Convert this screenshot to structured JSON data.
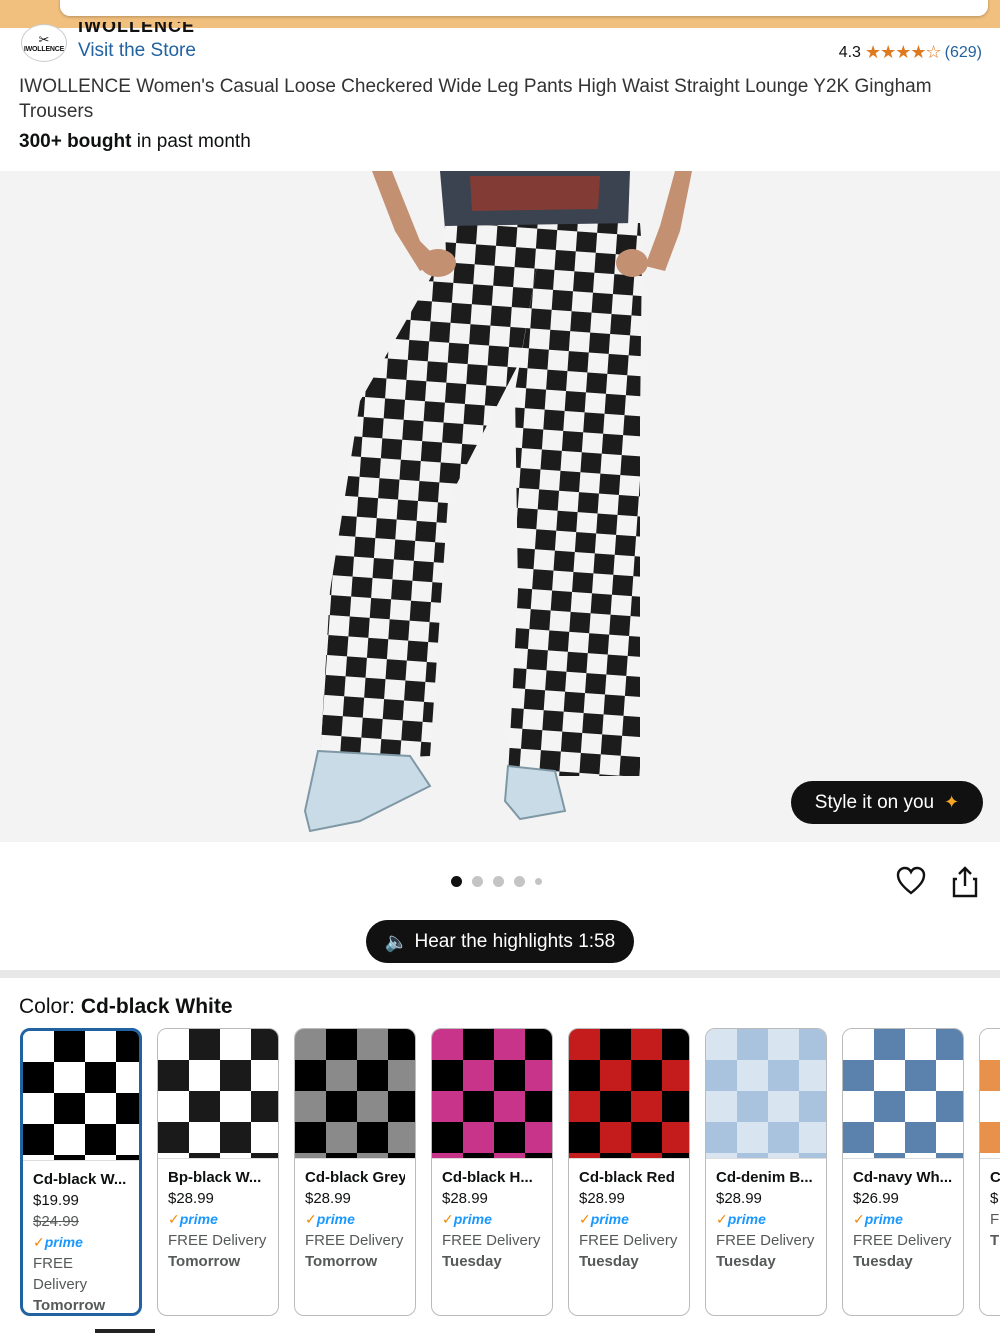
{
  "brand": {
    "name_cut": "IWOLLENCE",
    "logo_text": "IWOLLENCE",
    "visit_store": "Visit the Store"
  },
  "rating": {
    "value": "4.3",
    "stars": "★★★★☆",
    "count": "(629)"
  },
  "product": {
    "title": "IWOLLENCE Women's Casual Loose Checkered Wide Leg Pants High Waist Straight Lounge Y2K Gingham Trousers",
    "bought_bold": "300+ bought",
    "bought_rest": " in past month"
  },
  "image": {
    "style_button": "Style it on you",
    "dots_total": 5,
    "dots_active": 1
  },
  "audio": {
    "label": "Hear the highlights 1:58"
  },
  "color": {
    "label": "Color: ",
    "selected": "Cd-black White"
  },
  "swatches": [
    {
      "name": "Cd-black W...",
      "price": "$19.99",
      "was": "$24.99",
      "prime": "prime",
      "free": "FREE Delivery",
      "day": "Tomorrow",
      "c1": "#000000",
      "c2": "#ffffff"
    },
    {
      "name": "Bp-black W...",
      "price": "$28.99",
      "prime": "prime",
      "free": "FREE Delivery",
      "day": "Tomorrow",
      "c1": "#1a1a1a",
      "c2": "#ffffff"
    },
    {
      "name": "Cd-black Grey",
      "price": "$28.99",
      "prime": "prime",
      "free": "FREE Delivery",
      "day": "Tomorrow",
      "c1": "#000000",
      "c2": "#8a8a8a"
    },
    {
      "name": "Cd-black H...",
      "price": "$28.99",
      "prime": "prime",
      "free": "FREE Delivery",
      "day": "Tuesday",
      "c1": "#000000",
      "c2": "#c8348a"
    },
    {
      "name": "Cd-black Red",
      "price": "$28.99",
      "prime": "prime",
      "free": "FREE Delivery",
      "day": "Tuesday",
      "c1": "#000000",
      "c2": "#c41c1c"
    },
    {
      "name": "Cd-denim B...",
      "price": "$28.99",
      "prime": "prime",
      "free": "FREE Delivery",
      "day": "Tuesday",
      "c1": "#a9c3de",
      "c2": "#d8e5f1"
    },
    {
      "name": "Cd-navy Wh...",
      "price": "$26.99",
      "prime": "prime",
      "free": "FREE Delivery",
      "day": "Tuesday",
      "c1": "#5b82ad",
      "c2": "#ffffff"
    },
    {
      "name": "C",
      "price": "$",
      "prime": "",
      "free": "F",
      "day": "T",
      "c1": "#e8914a",
      "c2": "#ffffff"
    }
  ],
  "colors": {
    "link": "#2162a1",
    "star": "#de7921",
    "prime": "#1a98ff",
    "selected_border": "#2162a1"
  }
}
